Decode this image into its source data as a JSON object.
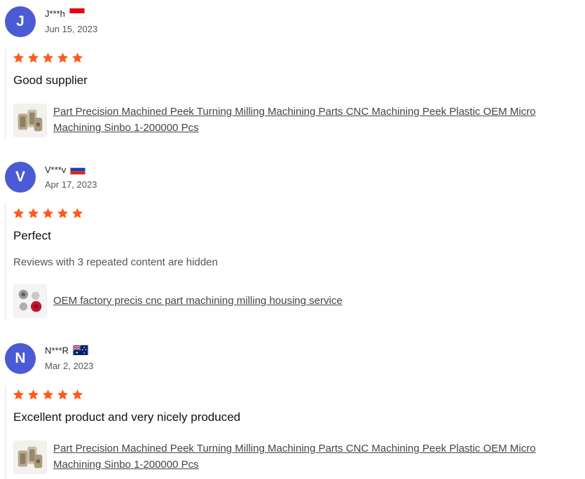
{
  "reviews": [
    {
      "initial": "J",
      "name": "J***h",
      "flag_icon": "indonesia-flag-icon",
      "date": "Jun 15, 2023",
      "rating": 5,
      "text": "Good supplier",
      "hidden_note": "",
      "product": {
        "thumb_icon": "machined-parts-thumbnail",
        "title": "Part Precision Machined Peek Turning Milling Machining Parts CNC Machining Peek Plastic OEM Micro Machining Sinbo 1-200000 Pcs"
      }
    },
    {
      "initial": "V",
      "name": "V***v",
      "flag_icon": "russia-flag-icon",
      "date": "Apr 17, 2023",
      "rating": 5,
      "text": "Perfect",
      "hidden_note": "Reviews with 3 repeated content are hidden",
      "product": {
        "thumb_icon": "housing-parts-thumbnail",
        "title": "OEM factory precis cnc part machining milling housing service"
      }
    },
    {
      "initial": "N",
      "name": "N***R",
      "flag_icon": "australia-flag-icon",
      "date": "Mar 2, 2023",
      "rating": 5,
      "text": "Excellent product and very nicely produced",
      "hidden_note": "",
      "product": {
        "thumb_icon": "machined-parts-thumbnail",
        "title": "Part Precision Machined Peek Turning Milling Machining Parts CNC Machining Peek Plastic OEM Micro Machining Sinbo 1-200000 Pcs"
      }
    }
  ],
  "colors": {
    "avatar": "#4b5bd6",
    "star": "#ff5b1a",
    "link": "#444444"
  }
}
